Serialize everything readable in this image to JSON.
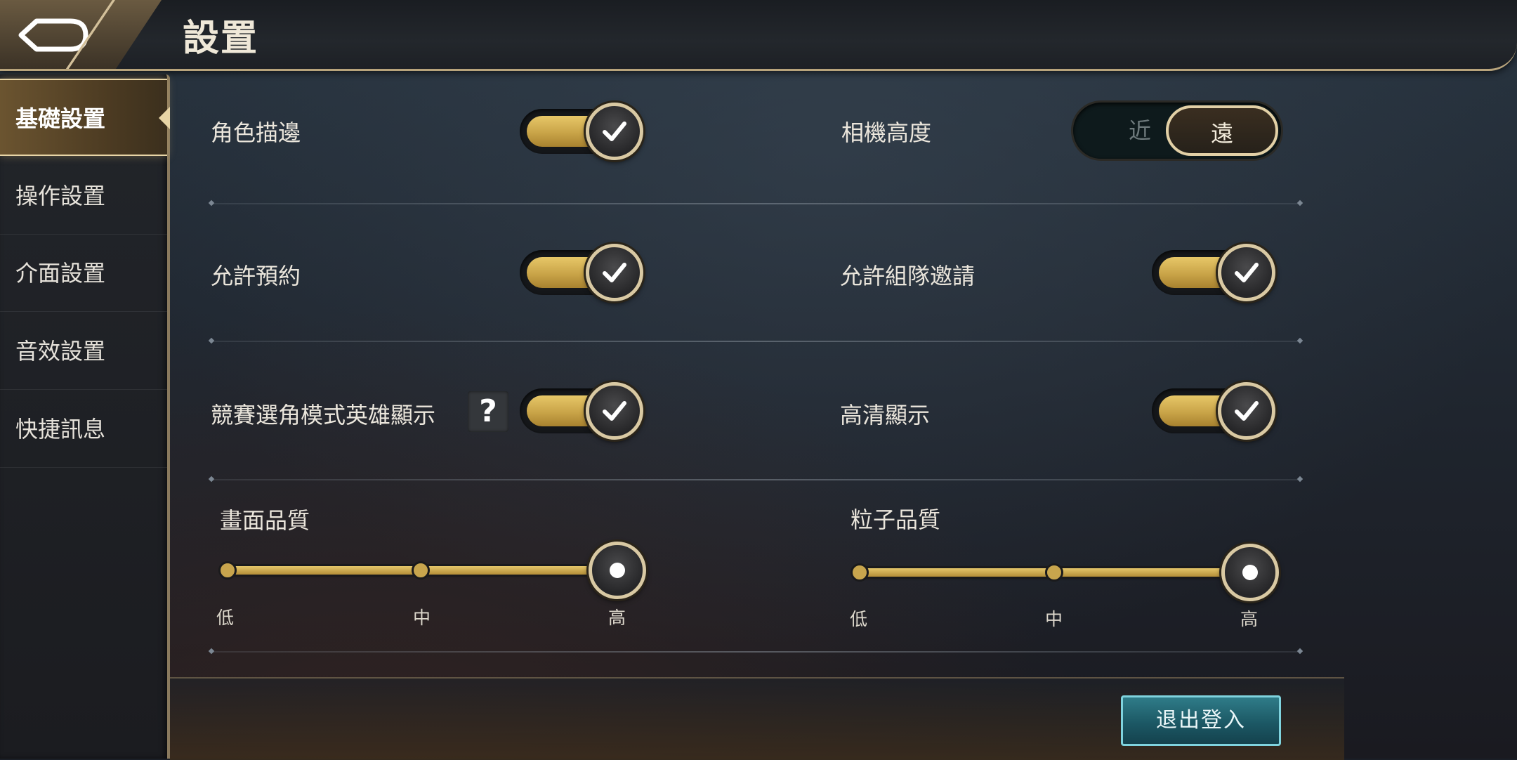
{
  "header": {
    "title": "設置"
  },
  "sidebar": {
    "items": [
      {
        "label": "基礎設置",
        "active": true
      },
      {
        "label": "操作設置"
      },
      {
        "label": "介面設置"
      },
      {
        "label": "音效設置"
      },
      {
        "label": "快捷訊息"
      }
    ]
  },
  "settings": {
    "character_outline": {
      "label": "角色描邊",
      "on": true
    },
    "camera_height": {
      "label": "相機高度",
      "near": "近",
      "far": "遠",
      "selected": "遠"
    },
    "allow_reservation": {
      "label": "允許預約",
      "on": true
    },
    "allow_team_invite": {
      "label": "允許組隊邀請",
      "on": true
    },
    "ranked_pick_hero_display": {
      "label": "競賽選角模式英雄顯示",
      "help": "?",
      "on": true
    },
    "hd_display": {
      "label": "高清顯示",
      "on": true
    },
    "graphics_quality": {
      "label": "畫面品質",
      "low": "低",
      "mid": "中",
      "high": "高",
      "value": "高"
    },
    "particle_quality": {
      "label": "粒子品質",
      "low": "低",
      "mid": "中",
      "high": "高",
      "value": "高"
    }
  },
  "footer": {
    "logout_label": "退出登入"
  },
  "colors": {
    "accent_gold": "#d9b85a",
    "logout_teal": "#1c5865"
  }
}
